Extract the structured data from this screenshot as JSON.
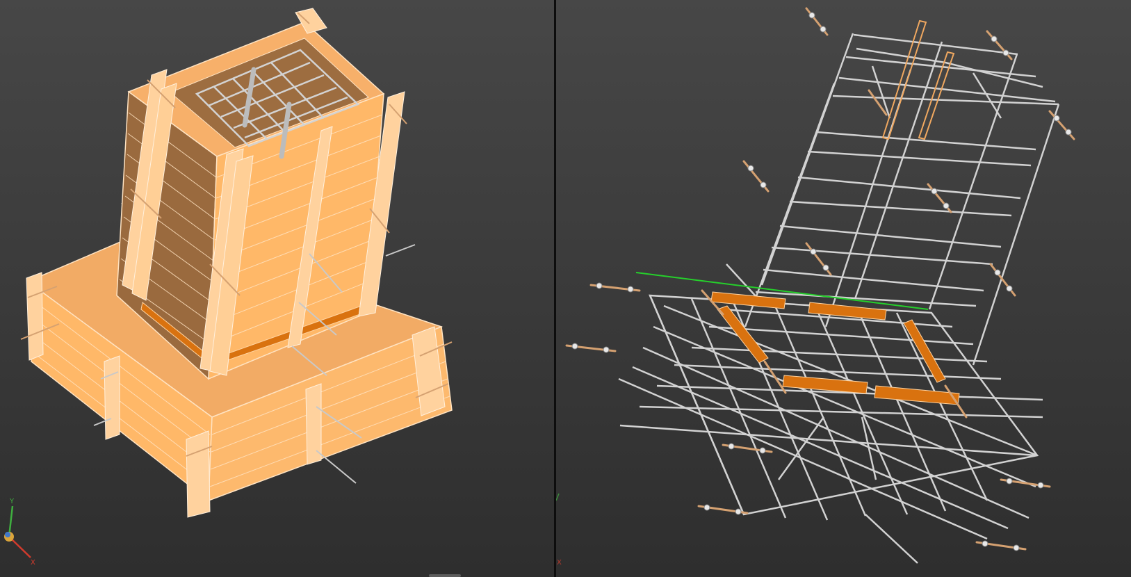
{
  "viewports": [
    {
      "name": "formwork-view",
      "gizmo": {
        "x_label": "X",
        "y_label": "Y",
        "x_color": "#d23b2d",
        "y_color": "#3fae3f",
        "z_color": "#d9a43a"
      }
    },
    {
      "name": "rebar-view",
      "gizmo": {
        "x_label": "X",
        "y_label": "Y",
        "x_color": "#b83a2d",
        "y_color": "#3d8f3d"
      }
    }
  ],
  "colors": {
    "background_top": "#474747",
    "background_bottom": "#2e2e2e",
    "timber_light": "#fbb96f",
    "timber_dark": "#9a6a3e",
    "timber_edge": "#ffe9cf",
    "rebar": "#c9c9c9",
    "steel_plate": "#d9720f",
    "tie_rod": "#d5a171",
    "selection_line": "#25d02b"
  },
  "icons": [
    "axis-gizmo-icon"
  ]
}
